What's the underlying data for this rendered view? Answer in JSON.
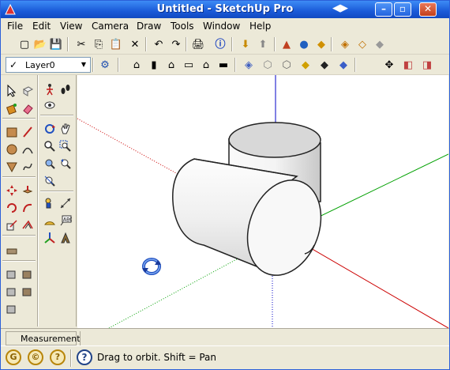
{
  "window": {
    "title": "Untitled - SketchUp Pro",
    "extra_icon": "◀▶",
    "minimize": "–",
    "maximize": "▫",
    "close": "✕",
    "app_icon": "sketchup-logo-icon"
  },
  "menu": {
    "items": [
      "File",
      "Edit",
      "View",
      "Camera",
      "Draw",
      "Tools",
      "Window",
      "Help"
    ]
  },
  "layer": {
    "current": "Layer0",
    "check": "✓",
    "arrow": "▼"
  },
  "toolbar1": {
    "icons": [
      "new-icon",
      "open-icon",
      "save-icon",
      "cut-icon",
      "copy-icon",
      "paste-icon",
      "erase-icon",
      "undo-icon",
      "redo-icon",
      "print-icon",
      "model-info-icon",
      "get-models-icon",
      "share-model-icon",
      "photo-textures-icon",
      "place-model-icon",
      "preview-icon",
      "share-component-icon",
      "extensions-icon",
      "dynamic-components-icon"
    ],
    "glyphs": [
      "▢",
      "📂",
      "💾",
      "✂",
      "⎘",
      "📋",
      "✕",
      "↶",
      "↷",
      "🖨",
      "ⓘ",
      "⬇",
      "⬆",
      "▲",
      "●",
      "◆",
      "◈",
      "◇",
      "◆"
    ]
  },
  "toolbar2": {
    "icons": [
      "layer-manager-icon",
      "iso-view-icon",
      "top-view-icon",
      "front-view-icon",
      "right-view-icon",
      "back-view-icon",
      "left-view-icon",
      "xray-icon",
      "wireframe-icon",
      "hidden-line-icon",
      "shaded-icon",
      "shaded-texture-icon",
      "monochrome-icon",
      "section-plane-icon",
      "display-section-icon",
      "display-cuts-icon"
    ],
    "glyphs": [
      "⚙",
      "⌂",
      "▮",
      "⌂",
      "▭",
      "⌂",
      "▬",
      "◈",
      "⬡",
      "⬡",
      "◆",
      "◆",
      "◆",
      "✥",
      "◧",
      "◨"
    ]
  },
  "left_tools": {
    "icons": [
      "select-icon",
      "component-icon",
      "walk-icon",
      "footprint-icon",
      "paint-bucket-icon",
      "eraser-icon",
      "look-around-icon",
      "rectangle-icon",
      "line-icon",
      "orbit-icon",
      "pan-icon",
      "circle-icon",
      "arc-icon",
      "zoom-icon",
      "zoom-window-icon",
      "polygon-icon",
      "freehand-icon",
      "zoom-extents-icon",
      "previous-icon",
      "zoom-extents-2-icon",
      "move-icon",
      "push-pull-icon",
      "position-camera-icon",
      "dimension-icon",
      "rotate-icon",
      "follow-me-icon",
      "protractor-icon",
      "text-icon",
      "scale-icon",
      "offset-icon",
      "axes-icon",
      "3d-text-icon",
      "sandbox-icon",
      "sandbox-contours-icon",
      "sandbox-scratch-icon",
      "smoove-icon",
      "stamp-icon",
      "drape-icon"
    ]
  },
  "measurements": {
    "label": "Measurements",
    "value": ""
  },
  "status": {
    "geo_icon": "G",
    "credit_icon": "©",
    "user_icon": "?",
    "text": "Drag to orbit.  Shift = Pan",
    "help_icon": "?"
  },
  "colors": {
    "titlebar": "#1a5ad8",
    "viewport_bg": "#ffffff",
    "axis_blue": "#0000c8",
    "axis_red": "#cc0000",
    "axis_green": "#00a000",
    "model_face": "#ececec"
  }
}
